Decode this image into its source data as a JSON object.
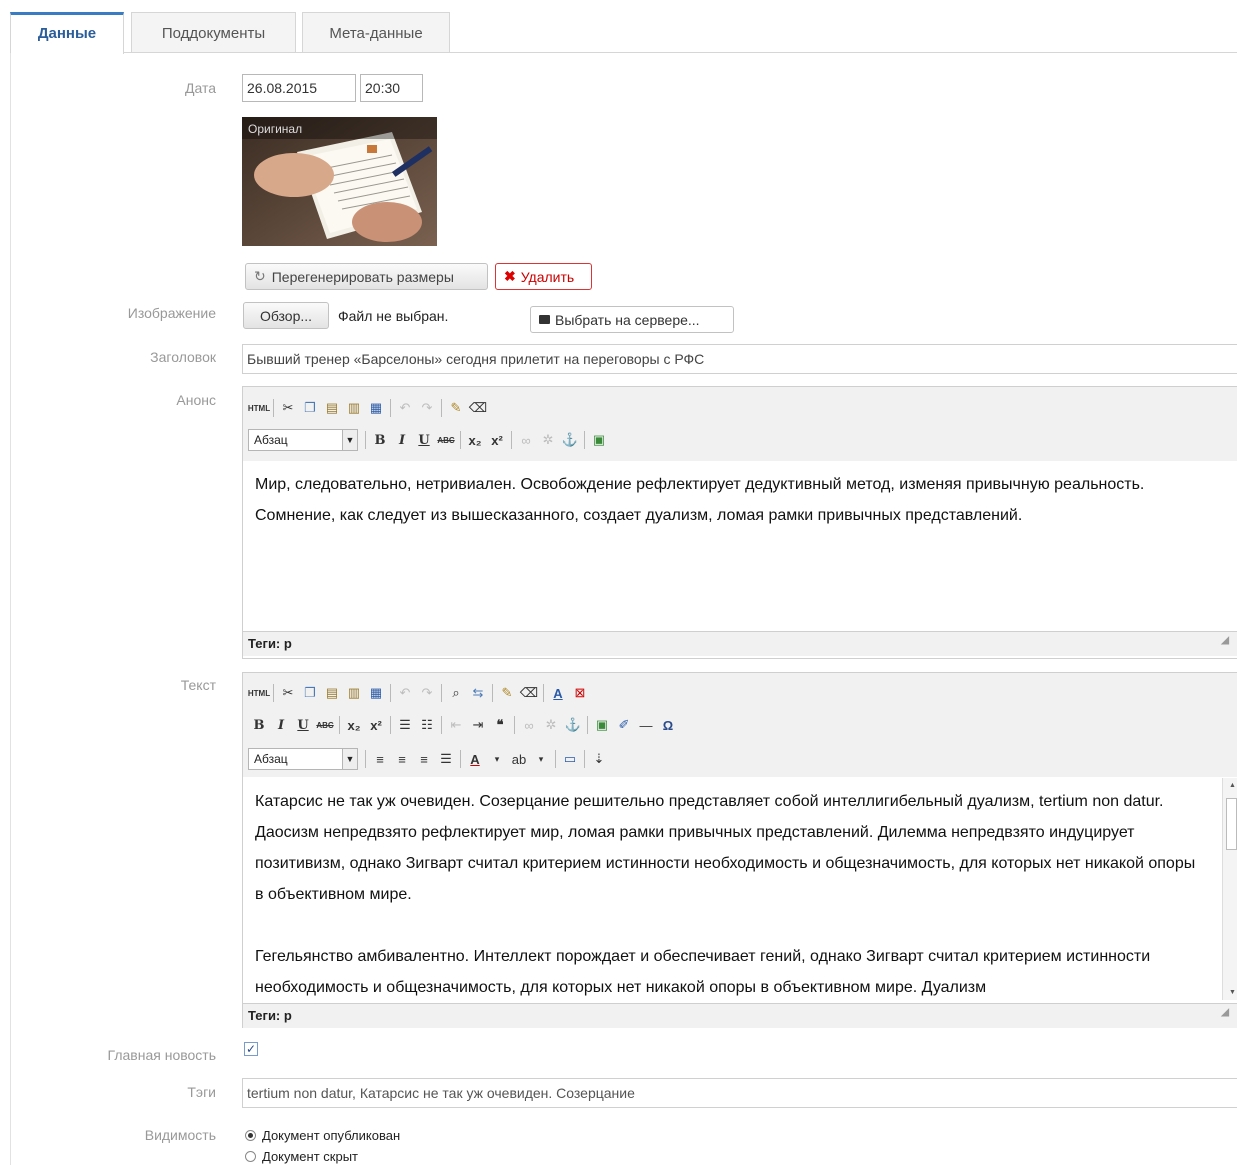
{
  "tabs": [
    "Данные",
    "Поддокументы",
    "Мета-данные"
  ],
  "labels": {
    "date": "Дата",
    "image": "Изображение",
    "title": "Заголовок",
    "announce": "Анонс",
    "text": "Текст",
    "main_news": "Главная новость",
    "tags": "Тэги",
    "visibility": "Видимость"
  },
  "date": {
    "value": "26.08.2015",
    "time": "20:30"
  },
  "image_caption": "Оригинал",
  "buttons": {
    "regenerate": "Перегенерировать размеры",
    "delete": "Удалить",
    "browse": "Обзор...",
    "no_file": "Файл не выбран.",
    "choose_server": "Выбрать на сервере..."
  },
  "title_value": "Бывший тренер «Барселоны» сегодня прилетит на переговоры с РФС",
  "announce": {
    "format": "Абзац",
    "text": "Мир, следовательно, нетривиален. Освобождение рефлектирует дедуктивный метод, изменяя привычную реальность. Сомнение, как следует из вышесказанного, создает дуализм, ломая рамки привычных представлений.",
    "status": "Теги: p"
  },
  "body": {
    "format": "Абзац",
    "paragraph1": "Катарсис не так уж очевиден. Созерцание решительно представляет собой интеллигибельный дуализм, tertium non datur. Даосизм непредвзято рефлектирует мир, ломая рамки привычных представлений. Дилемма непредвзято индуцирует позитивизм, однако Зигварт считал критерием истинности необходимость и общезначимость, для которых нет никакой опоры в объективном мире.",
    "paragraph2": "Гегельянство амбивалентно. Интеллект порождает и обеспечивает гений, однако Зигварт считал критерием истинности необходимость и общезначимость, для которых нет никакой опоры в объективном мире. Дуализм",
    "status": "Теги: p"
  },
  "main_news_checked": true,
  "tags_value": "tertium non datur, Катарсис не так уж очевиден. Созерцание",
  "visibility": {
    "published": "Документ опубликован",
    "hidden": "Документ скрыт",
    "selected": "published"
  },
  "toolbar_labels": {
    "html": "HTML",
    "bold": "B",
    "italic": "I",
    "underline": "U",
    "strike": "ABC",
    "omega": "Ω"
  }
}
